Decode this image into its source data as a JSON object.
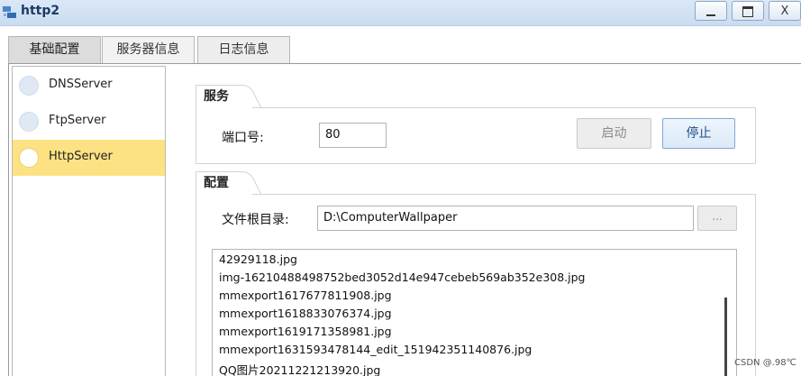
{
  "window": {
    "title": "http2",
    "icon": "http-server-icon",
    "min_label": "",
    "max_label": "",
    "close_label": "X"
  },
  "tabs": [
    {
      "label": "基础配置"
    },
    {
      "label": "服务器信息"
    },
    {
      "label": "日志信息"
    }
  ],
  "sidebar": {
    "items": [
      {
        "label": "DNSServer",
        "selected": false
      },
      {
        "label": "FtpServer",
        "selected": false
      },
      {
        "label": "HttpServer",
        "selected": true
      }
    ]
  },
  "service": {
    "group_title": "服务",
    "port_label": "端口号:",
    "port_value": "80",
    "start_label": "启动",
    "stop_label": "停止"
  },
  "config": {
    "group_title": "配置",
    "root_label": "文件根目录:",
    "root_value": "D:\\ComputerWallpaper",
    "browse_label": "...",
    "files": [
      "42929118.jpg",
      "img-16210488498752bed3052d14e947cebeb569ab352e308.jpg",
      "mmexport1617677811908.jpg",
      "mmexport1618833076374.jpg",
      "mmexport1619171358981.jpg",
      "mmexport1631593478144_edit_151942351140876.jpg",
      "QQ图片20211221213920.jpg"
    ]
  },
  "watermark": "CSDN @.98℃",
  "colors": {
    "selected_item": "#fde283",
    "stop_button_text": "#1e4f8a",
    "titlebar": "#c9dcf0"
  }
}
